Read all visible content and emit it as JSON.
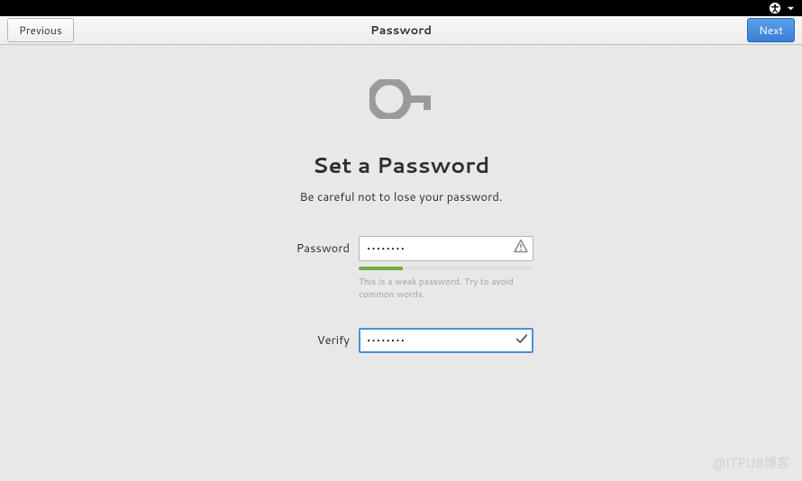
{
  "topbar": {
    "accessibility_icon": "accessibility",
    "dropdown_icon": "triangle-down"
  },
  "header": {
    "previous_label": "Previous",
    "title": "Password",
    "next_label": "Next"
  },
  "content": {
    "title": "Set a Password",
    "subtitle": "Be careful not to lose your password.",
    "password_label": "Password",
    "password_value": "••••••••",
    "password_strength_percent": 25,
    "password_hint": "This is a weak password. Try to avoid common words.",
    "verify_label": "Verify",
    "verify_value": "••••••••",
    "verify_match": true
  },
  "watermark": "@ITPUB博客"
}
